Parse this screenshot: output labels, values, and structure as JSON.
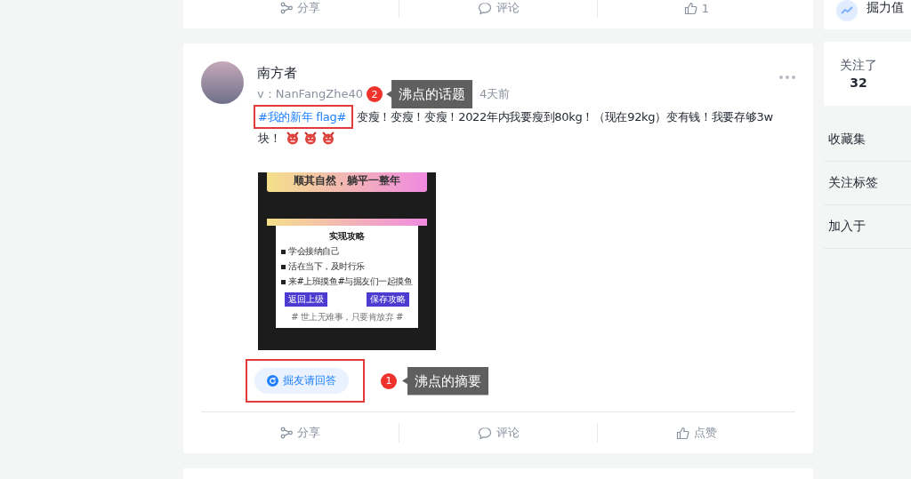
{
  "prev_post": {
    "actions": [
      {
        "kind": "share",
        "label": "分享"
      },
      {
        "kind": "comment",
        "label": "评论"
      },
      {
        "kind": "like",
        "label": "1"
      }
    ]
  },
  "post": {
    "author": "南方者",
    "meta": "v：NanFangZhe40",
    "time": "4天前",
    "topic": "#我的新年 flag#",
    "text": "变瘦！变瘦！变瘦！2022年内我要瘦到80kg！（现在92kg）变有钱！我要存够3w块！",
    "emojis": [
      {
        "kind": "devil"
      },
      {
        "kind": "devil"
      },
      {
        "kind": "devil"
      }
    ],
    "topic_annotation": {
      "number": "2",
      "label": "沸点的话题"
    },
    "image": {
      "banner": "顺其自然，躺平一整年",
      "card_title": "实现攻略",
      "items": [
        "学会接纳自己",
        "活在当下，及时行乐",
        "来#上班摸鱼#与掘友们一起摸鱼"
      ],
      "buttons": [
        "返回上级",
        "保存攻略"
      ],
      "footer": "# 世上无难事，只要肯放弃 #"
    },
    "answer_button": "掘友请回答",
    "answer_annotation": {
      "number": "1",
      "label": "沸点的摘要"
    },
    "actions": [
      {
        "kind": "share",
        "label": "分享"
      },
      {
        "kind": "comment",
        "label": "评论"
      },
      {
        "kind": "like",
        "label": "点赞"
      }
    ]
  },
  "sidebar": {
    "stat_partial": "掘力值",
    "following": {
      "label": "关注了",
      "count": "32"
    },
    "links": [
      "收藏集",
      "关注标签",
      "加入于"
    ]
  }
}
